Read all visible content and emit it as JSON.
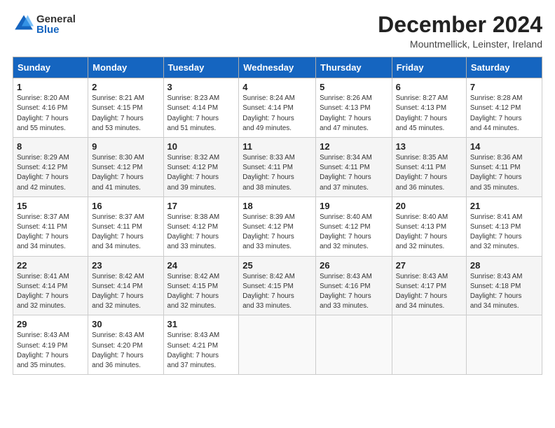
{
  "header": {
    "logo_general": "General",
    "logo_blue": "Blue",
    "month_title": "December 2024",
    "location": "Mountmellick, Leinster, Ireland"
  },
  "days_of_week": [
    "Sunday",
    "Monday",
    "Tuesday",
    "Wednesday",
    "Thursday",
    "Friday",
    "Saturday"
  ],
  "weeks": [
    [
      {
        "day": "1",
        "sunrise": "8:20 AM",
        "sunset": "4:16 PM",
        "daylight": "7 hours and 55 minutes."
      },
      {
        "day": "2",
        "sunrise": "8:21 AM",
        "sunset": "4:15 PM",
        "daylight": "7 hours and 53 minutes."
      },
      {
        "day": "3",
        "sunrise": "8:23 AM",
        "sunset": "4:14 PM",
        "daylight": "7 hours and 51 minutes."
      },
      {
        "day": "4",
        "sunrise": "8:24 AM",
        "sunset": "4:14 PM",
        "daylight": "7 hours and 49 minutes."
      },
      {
        "day": "5",
        "sunrise": "8:26 AM",
        "sunset": "4:13 PM",
        "daylight": "7 hours and 47 minutes."
      },
      {
        "day": "6",
        "sunrise": "8:27 AM",
        "sunset": "4:13 PM",
        "daylight": "7 hours and 45 minutes."
      },
      {
        "day": "7",
        "sunrise": "8:28 AM",
        "sunset": "4:12 PM",
        "daylight": "7 hours and 44 minutes."
      }
    ],
    [
      {
        "day": "8",
        "sunrise": "8:29 AM",
        "sunset": "4:12 PM",
        "daylight": "7 hours and 42 minutes."
      },
      {
        "day": "9",
        "sunrise": "8:30 AM",
        "sunset": "4:12 PM",
        "daylight": "7 hours and 41 minutes."
      },
      {
        "day": "10",
        "sunrise": "8:32 AM",
        "sunset": "4:12 PM",
        "daylight": "7 hours and 39 minutes."
      },
      {
        "day": "11",
        "sunrise": "8:33 AM",
        "sunset": "4:11 PM",
        "daylight": "7 hours and 38 minutes."
      },
      {
        "day": "12",
        "sunrise": "8:34 AM",
        "sunset": "4:11 PM",
        "daylight": "7 hours and 37 minutes."
      },
      {
        "day": "13",
        "sunrise": "8:35 AM",
        "sunset": "4:11 PM",
        "daylight": "7 hours and 36 minutes."
      },
      {
        "day": "14",
        "sunrise": "8:36 AM",
        "sunset": "4:11 PM",
        "daylight": "7 hours and 35 minutes."
      }
    ],
    [
      {
        "day": "15",
        "sunrise": "8:37 AM",
        "sunset": "4:11 PM",
        "daylight": "7 hours and 34 minutes."
      },
      {
        "day": "16",
        "sunrise": "8:37 AM",
        "sunset": "4:11 PM",
        "daylight": "7 hours and 34 minutes."
      },
      {
        "day": "17",
        "sunrise": "8:38 AM",
        "sunset": "4:12 PM",
        "daylight": "7 hours and 33 minutes."
      },
      {
        "day": "18",
        "sunrise": "8:39 AM",
        "sunset": "4:12 PM",
        "daylight": "7 hours and 33 minutes."
      },
      {
        "day": "19",
        "sunrise": "8:40 AM",
        "sunset": "4:12 PM",
        "daylight": "7 hours and 32 minutes."
      },
      {
        "day": "20",
        "sunrise": "8:40 AM",
        "sunset": "4:13 PM",
        "daylight": "7 hours and 32 minutes."
      },
      {
        "day": "21",
        "sunrise": "8:41 AM",
        "sunset": "4:13 PM",
        "daylight": "7 hours and 32 minutes."
      }
    ],
    [
      {
        "day": "22",
        "sunrise": "8:41 AM",
        "sunset": "4:14 PM",
        "daylight": "7 hours and 32 minutes."
      },
      {
        "day": "23",
        "sunrise": "8:42 AM",
        "sunset": "4:14 PM",
        "daylight": "7 hours and 32 minutes."
      },
      {
        "day": "24",
        "sunrise": "8:42 AM",
        "sunset": "4:15 PM",
        "daylight": "7 hours and 32 minutes."
      },
      {
        "day": "25",
        "sunrise": "8:42 AM",
        "sunset": "4:15 PM",
        "daylight": "7 hours and 33 minutes."
      },
      {
        "day": "26",
        "sunrise": "8:43 AM",
        "sunset": "4:16 PM",
        "daylight": "7 hours and 33 minutes."
      },
      {
        "day": "27",
        "sunrise": "8:43 AM",
        "sunset": "4:17 PM",
        "daylight": "7 hours and 34 minutes."
      },
      {
        "day": "28",
        "sunrise": "8:43 AM",
        "sunset": "4:18 PM",
        "daylight": "7 hours and 34 minutes."
      }
    ],
    [
      {
        "day": "29",
        "sunrise": "8:43 AM",
        "sunset": "4:19 PM",
        "daylight": "7 hours and 35 minutes."
      },
      {
        "day": "30",
        "sunrise": "8:43 AM",
        "sunset": "4:20 PM",
        "daylight": "7 hours and 36 minutes."
      },
      {
        "day": "31",
        "sunrise": "8:43 AM",
        "sunset": "4:21 PM",
        "daylight": "7 hours and 37 minutes."
      },
      null,
      null,
      null,
      null
    ]
  ],
  "labels": {
    "sunrise": "Sunrise:",
    "sunset": "Sunset:",
    "daylight": "Daylight:"
  }
}
